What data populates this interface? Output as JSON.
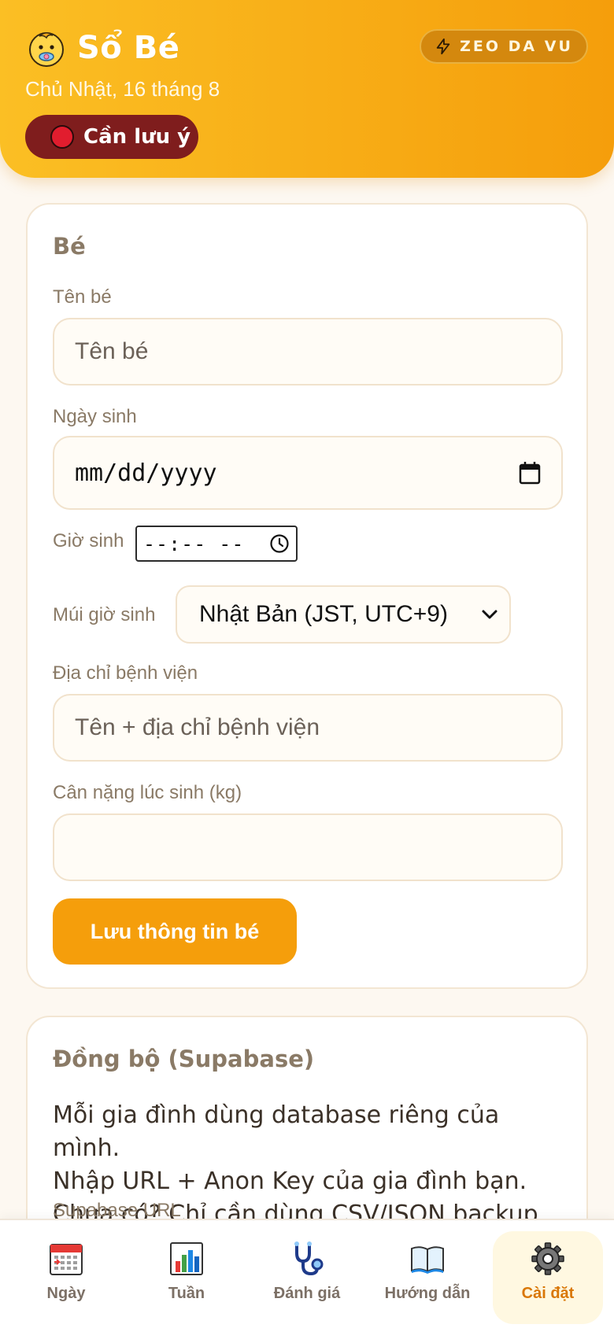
{
  "header": {
    "app_title": "Sổ Bé",
    "date": "Chủ Nhật, 16 tháng 8",
    "alert_label": "Cần lưu ý",
    "mode_label": "ZEO DA VU",
    "accent_color": "#f59e0b",
    "alert_color": "#7f1d1d"
  },
  "baby_card": {
    "title": "Bé",
    "name_label": "Tên bé",
    "name_placeholder": "Tên bé",
    "name_value": "",
    "dob_label": "Ngày sinh",
    "dob_placeholder": "mm/dd/yyyy",
    "birth_time_label": "Giờ sinh",
    "birth_time_placeholder": "--:-- --",
    "timezone_label": "Múi giờ sinh",
    "timezone_selected": "Nhật Bản (JST, UTC+9)",
    "hospital_label": "Địa chỉ bệnh viện",
    "hospital_placeholder": "Tên + địa chỉ bệnh viện",
    "hospital_value": "",
    "weight_label": "Cân nặng lúc sinh (kg)",
    "weight_value": "",
    "save_button": "Lưu thông tin bé"
  },
  "sync_card": {
    "title": "Đồng bộ (Supabase)",
    "desc_line1": "Mỗi gia đình dùng database riêng của mình.",
    "desc_line2": "Nhập URL + Anon Key của gia đình bạn.",
    "desc_line3": "Chưa có? Chỉ cần dùng CSV/JSON backup.",
    "url_label": "Supabase URL"
  },
  "nav": {
    "items": [
      {
        "label": "Ngày",
        "icon": "calendar-icon"
      },
      {
        "label": "Tuần",
        "icon": "bar-chart-icon"
      },
      {
        "label": "Đánh giá",
        "icon": "stethoscope-icon"
      },
      {
        "label": "Hướng dẫn",
        "icon": "book-icon"
      },
      {
        "label": "Cài đặt",
        "icon": "gear-icon"
      }
    ],
    "active": "Cài đặt"
  }
}
